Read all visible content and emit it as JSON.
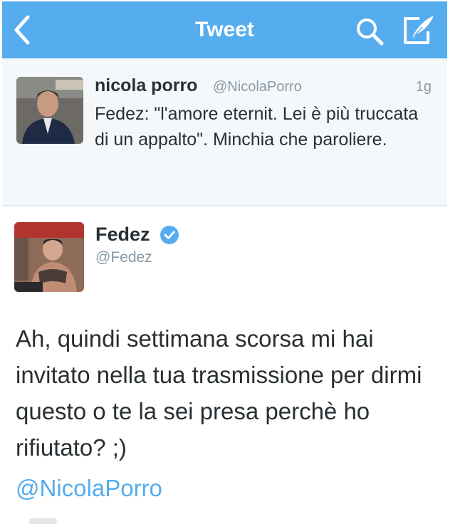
{
  "navbar": {
    "title": "Tweet",
    "back_icon": "chevron-left-icon",
    "search_icon": "search-icon",
    "compose_icon": "compose-icon",
    "background_color": "#55acee"
  },
  "previous_tweet": {
    "author_name": "nicola porro",
    "author_handle": "@NicolaPorro",
    "time": "1g",
    "text": "Fedez: \"l'amore eternit. Lei è più truccata di un appalto\". Minchia che paroliere."
  },
  "main_tweet": {
    "author_name": "Fedez",
    "author_handle": "@Fedez",
    "verified": true,
    "text": "Ah, quindi settimana scorsa mi hai invitato nella tua trasmissione per dirmi questo o te la sei presa perchè ho rifiutato? ;)",
    "mention": "@NicolaPorro",
    "mention_color": "#55acee"
  }
}
